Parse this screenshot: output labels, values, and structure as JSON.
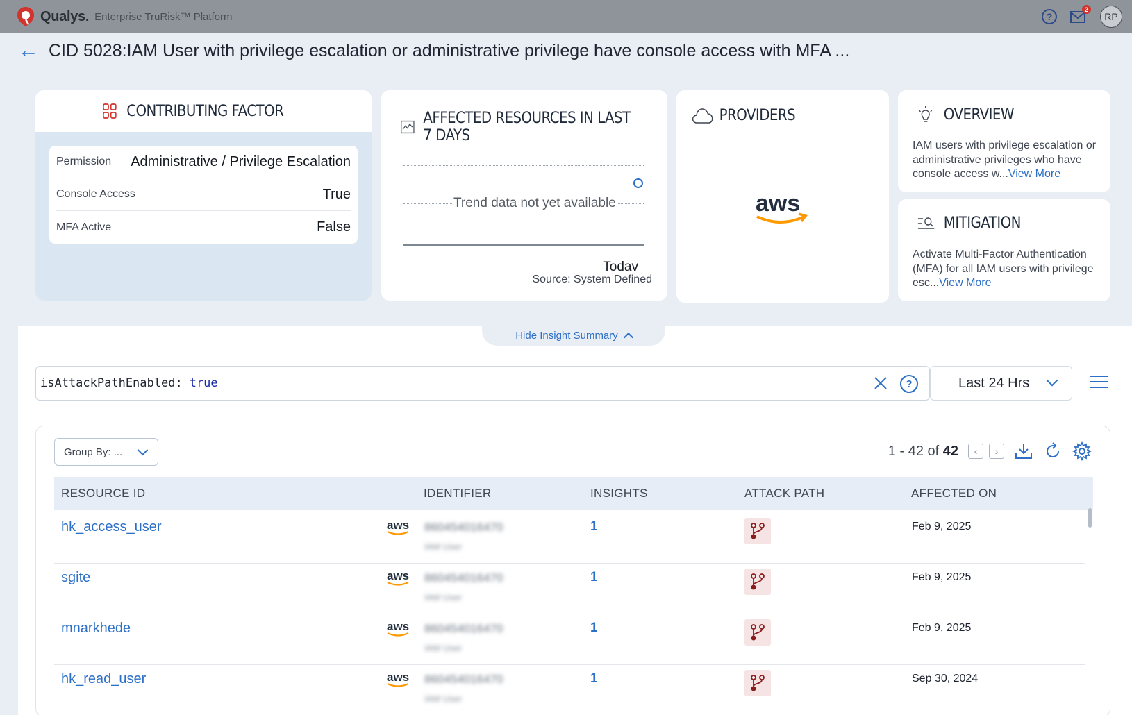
{
  "header": {
    "brand": "Qualys.",
    "product": "Enterprise TruRisk™ Platform",
    "notif_count": "2",
    "avatar": "RP",
    "help_icon": "question-circle-icon",
    "mail_icon": "mail-icon"
  },
  "page": {
    "back_icon": "arrow-left-icon",
    "title": "CID 5028:IAM User with privilege escalation or administrative privilege have console access with MFA ..."
  },
  "contributing": {
    "title": "CONTRIBUTING FACTOR",
    "icon": "grid-icon",
    "rows": [
      {
        "key": "Permission",
        "value": "Administrative / Privilege Escalation"
      },
      {
        "key": "Console Access",
        "value": "True"
      },
      {
        "key": "MFA Active",
        "value": "False"
      }
    ]
  },
  "affected": {
    "title": "AFFECTED RESOURCES IN LAST 7 DAYS",
    "icon": "chart-line-icon",
    "empty_text": "Trend data not yet available",
    "today": "Todav",
    "source": "Source: System Defined"
  },
  "providers": {
    "title": "PROVIDERS",
    "icon": "cloud-icon",
    "logo": "aws-logo"
  },
  "overview": {
    "title": "OVERVIEW",
    "icon": "lightbulb-icon",
    "text": "IAM users with privilege escalation or administrative privileges who have console access w...",
    "link": "View More"
  },
  "mitigation": {
    "title": "MITIGATION",
    "icon": "list-search-icon",
    "text": "Activate Multi-Factor Authentication (MFA) for all IAM users with privilege esc...",
    "link": "View More"
  },
  "insight_toggle": "Hide Insight Summary",
  "search": {
    "query_key": "isAttackPathEnabled:",
    "query_value": "true"
  },
  "time_filter": "Last 24 Hrs",
  "table": {
    "group_by": "Group By: ...",
    "count_prefix": "1 - 42 of",
    "count_total": "42",
    "columns": [
      "RESOURCE ID",
      "IDENTIFIER",
      "INSIGHTS",
      "ATTACK PATH",
      "AFFECTED ON"
    ],
    "rows": [
      {
        "resource": "hk_access_user",
        "provider": "aws",
        "identifier": "860454016470",
        "identifier_type": "IAM User",
        "insights": "1",
        "affected_on": "Feb 9, 2025"
      },
      {
        "resource": "sgite",
        "provider": "aws",
        "identifier": "860454016470",
        "identifier_type": "IAM User",
        "insights": "1",
        "affected_on": "Feb 9, 2025"
      },
      {
        "resource": "mnarkhede",
        "provider": "aws",
        "identifier": "860454016470",
        "identifier_type": "IAM User",
        "insights": "1",
        "affected_on": "Feb 9, 2025"
      },
      {
        "resource": "hk_read_user",
        "provider": "aws",
        "identifier": "860454016470",
        "identifier_type": "IAM User",
        "insights": "1",
        "affected_on": "Sep 30, 2024"
      }
    ]
  },
  "colors": {
    "accent": "#2c6fc6",
    "brand_red": "#d0342c",
    "aws_orange": "#f90"
  }
}
